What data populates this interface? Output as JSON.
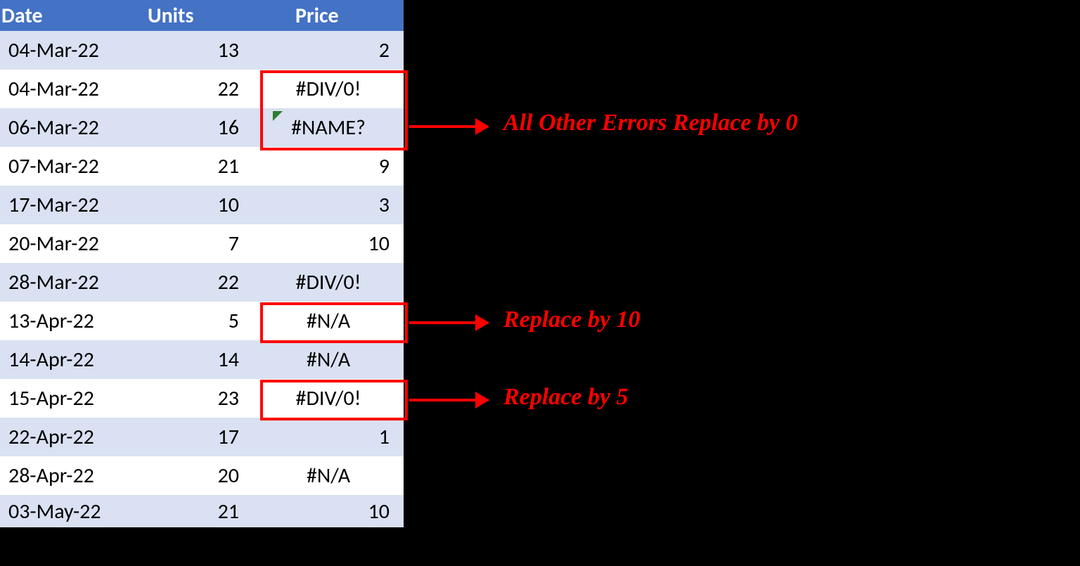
{
  "headers": {
    "date": "Date",
    "units": "Units",
    "price": "Price"
  },
  "rows": [
    {
      "date": "04-Mar-22",
      "units": "13",
      "price": "2",
      "price_align": "right"
    },
    {
      "date": "04-Mar-22",
      "units": "22",
      "price": "#DIV/0!",
      "price_align": "center"
    },
    {
      "date": "06-Mar-22",
      "units": "16",
      "price": "#NAME?",
      "price_align": "center",
      "flag": true
    },
    {
      "date": "07-Mar-22",
      "units": "21",
      "price": "9",
      "price_align": "right"
    },
    {
      "date": "17-Mar-22",
      "units": "10",
      "price": "3",
      "price_align": "right"
    },
    {
      "date": "20-Mar-22",
      "units": "7",
      "price": "10",
      "price_align": "right"
    },
    {
      "date": "28-Mar-22",
      "units": "22",
      "price": "#DIV/0!",
      "price_align": "center"
    },
    {
      "date": "13-Apr-22",
      "units": "5",
      "price": "#N/A",
      "price_align": "center"
    },
    {
      "date": "14-Apr-22",
      "units": "14",
      "price": "#N/A",
      "price_align": "center"
    },
    {
      "date": "15-Apr-22",
      "units": "23",
      "price": "#DIV/0!",
      "price_align": "center"
    },
    {
      "date": "22-Apr-22",
      "units": "17",
      "price": "1",
      "price_align": "right"
    },
    {
      "date": "28-Apr-22",
      "units": "20",
      "price": "#N/A",
      "price_align": "center"
    },
    {
      "date": "03-May-22",
      "units": "21",
      "price": "10",
      "price_align": "right"
    }
  ],
  "annotations": {
    "box1_text": "All Other Errors Replace by 0",
    "box2_text": "Replace by 10",
    "box3_text": "Replace by 5"
  }
}
